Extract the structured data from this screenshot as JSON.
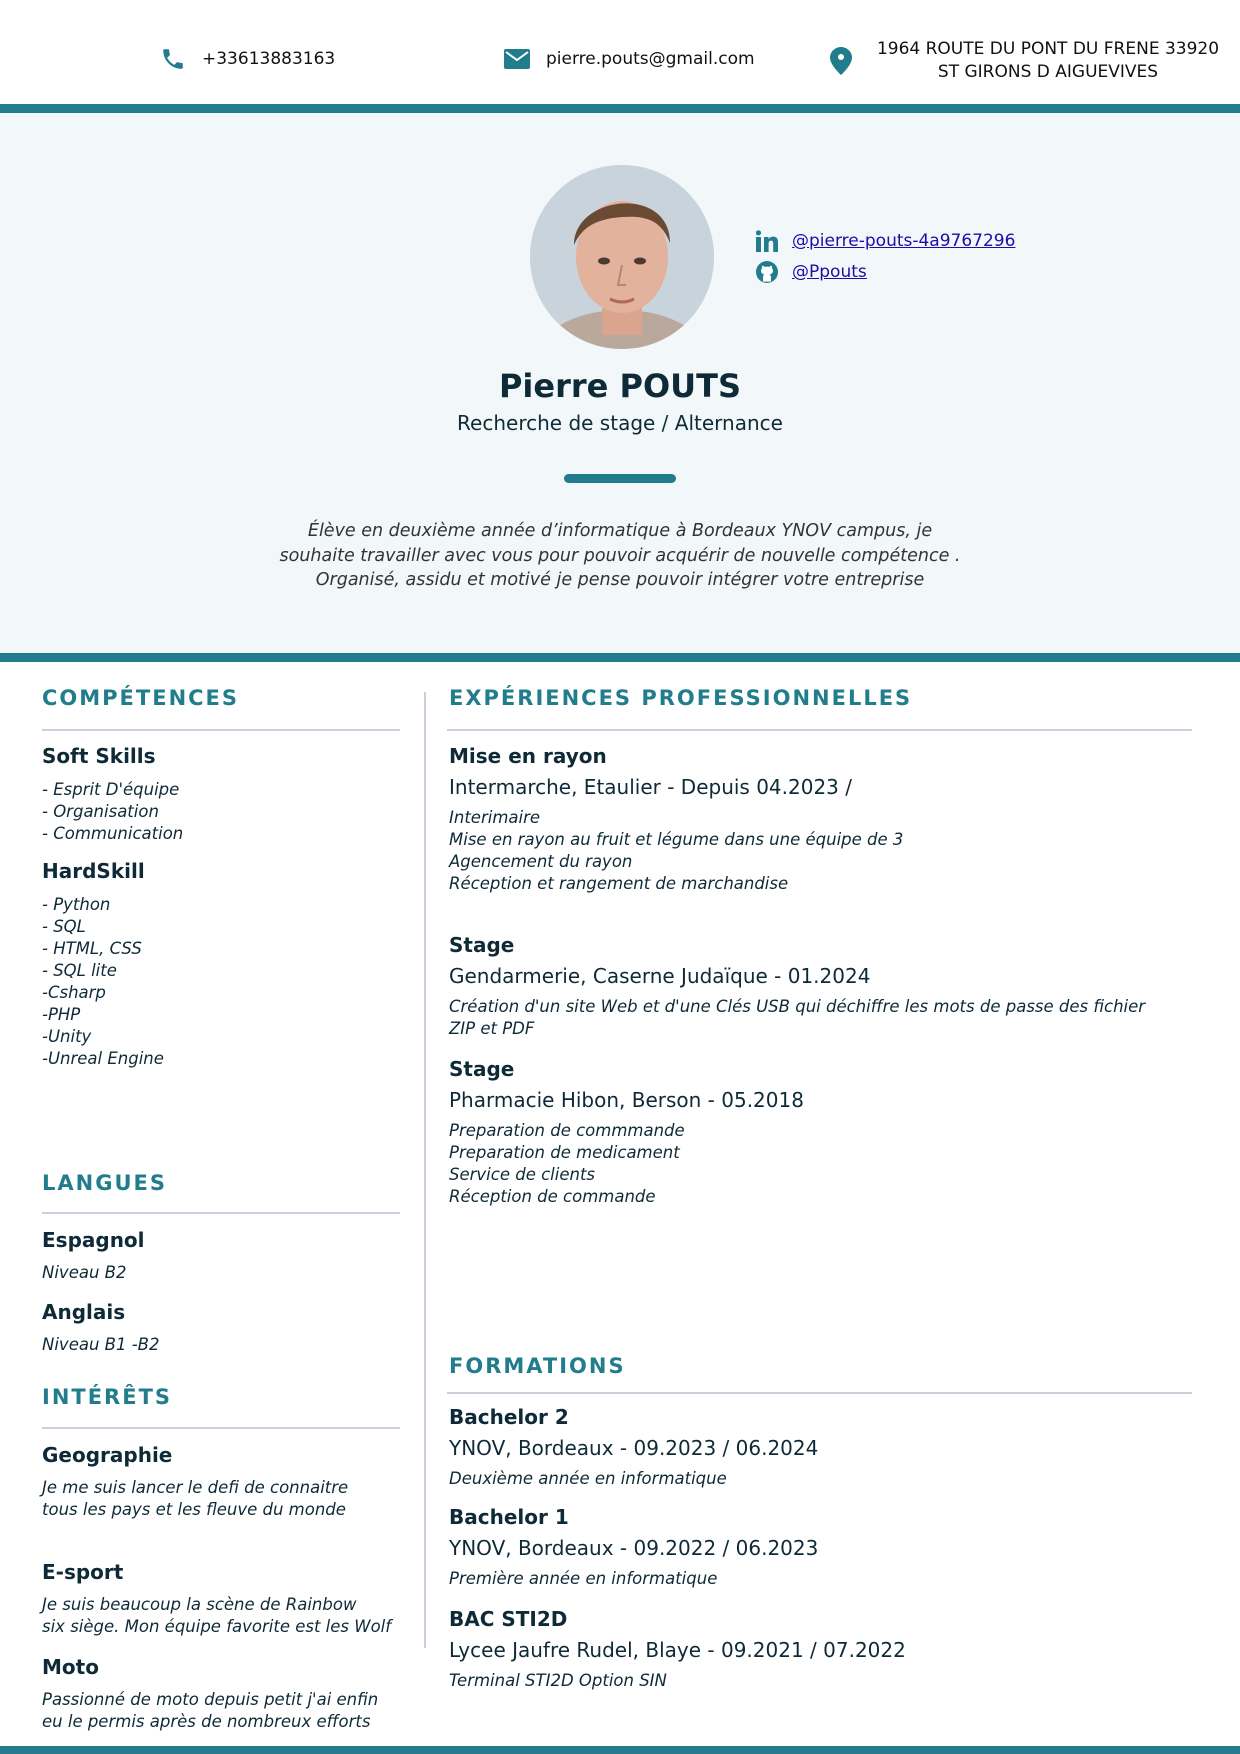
{
  "contact": {
    "phone": "+33613883163",
    "email": "pierre.pouts@gmail.com",
    "address_line1": "1964 ROUTE DU PONT DU FRENE 33920",
    "address_line2": "ST GIRONS D AIGUEVIVES"
  },
  "social": {
    "linkedin": "@pierre-pouts-4a9767296",
    "github": "@Ppouts"
  },
  "profile": {
    "name": "Pierre POUTS",
    "subtitle": "Recherche de stage / Alternance",
    "summary": [
      "Élève en deuxième année d’informatique à Bordeaux YNOV campus, je",
      "souhaite travailler avec vous pour pouvoir acquérir de nouvelle compétence .",
      "Organisé, assidu et motivé je pense pouvoir intégrer votre entreprise"
    ]
  },
  "skills": {
    "title": "COMPÉTENCES",
    "soft_title": "Soft Skills",
    "soft": [
      "- Esprit D'équipe",
      "- Organisation",
      "- Communication"
    ],
    "hard_title": "HardSkill",
    "hard": [
      "- Python",
      "- SQL",
      "- HTML, CSS",
      "- SQL lite",
      "-Csharp",
      "-PHP",
      "-Unity",
      "-Unreal Engine"
    ]
  },
  "languages": {
    "title": "LANGUES",
    "items": [
      {
        "name": "Espagnol",
        "level": "Niveau B2"
      },
      {
        "name": "Anglais",
        "level": "Niveau B1 -B2"
      }
    ]
  },
  "interests": {
    "title": "INTÉRÊTS",
    "items": [
      {
        "name": "Geographie",
        "lines": [
          "Je me suis lancer le defi de connaitre",
          "tous les pays et les fleuve du monde"
        ]
      },
      {
        "name": "E-sport",
        "lines": [
          "Je suis beaucoup la scène de Rainbow",
          "six siège. Mon équipe favorite est les Wolf"
        ]
      },
      {
        "name": "Moto",
        "lines": [
          "Passionné de moto depuis petit j'ai enfin",
          "eu le permis après de nombreux efforts"
        ]
      }
    ]
  },
  "experience": {
    "title": "EXPÉRIENCES PROFESSIONNELLES",
    "items": [
      {
        "title": "Mise en rayon",
        "sub": "Intermarche, Etaulier - Depuis 04.2023 /",
        "lines": [
          "Interimaire",
          "Mise en rayon au fruit et légume dans une équipe de 3",
          "Agencement du rayon",
          "Réception et rangement de marchandise"
        ]
      },
      {
        "title": "Stage",
        "sub": "Gendarmerie, Caserne Judaïque  - 01.2024",
        "lines": [
          "Création d'un site Web et d'une Clés USB qui déchiffre les mots de passe des fichier",
          "ZIP et PDF"
        ]
      },
      {
        "title": "Stage",
        "sub": "Pharmacie Hibon, Berson - 05.2018",
        "lines": [
          "Preparation de commmande",
          "Preparation de medicament",
          "Service de clients",
          "Réception de commande"
        ]
      }
    ]
  },
  "education": {
    "title": "FORMATIONS",
    "items": [
      {
        "title": "Bachelor 2",
        "sub": "YNOV, Bordeaux - 09.2023 / 06.2024",
        "lines": [
          "Deuxième année en informatique"
        ]
      },
      {
        "title": "Bachelor 1",
        "sub": "YNOV, Bordeaux - 09.2022 / 06.2023",
        "lines": [
          "Première année en informatique"
        ]
      },
      {
        "title": "BAC STI2D",
        "sub": "Lycee Jaufre Rudel, Blaye - 09.2021 / 07.2022",
        "lines": [
          "Terminal STI2D Option SIN"
        ]
      }
    ]
  },
  "colors": {
    "accent": "#217c8c",
    "text": "#0f2a37",
    "hero_bg": "#f2f7f9"
  },
  "icons": [
    "phone-icon",
    "email-icon",
    "location-pin-icon",
    "linkedin-icon",
    "github-icon"
  ]
}
